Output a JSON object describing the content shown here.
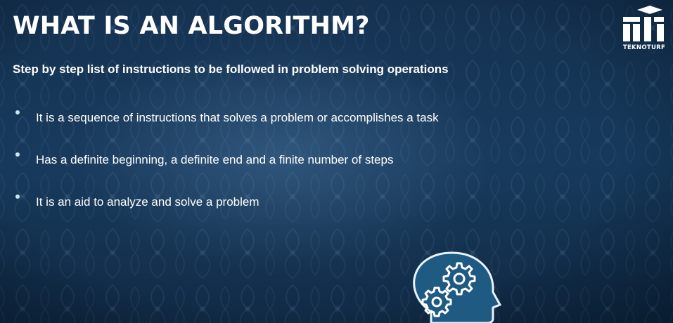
{
  "slide": {
    "title": "WHAT IS AN ALGORITHM?",
    "subtitle": "Step by step list of instructions to be followed in problem solving operations",
    "bullets": [
      "It is a sequence of instructions that solves a problem or accomplishes a task",
      "Has a definite beginning, a definite end and a finite number of steps",
      "It is an aid to analyze and solve a problem"
    ]
  },
  "logo": {
    "text": "TEKNOTURF",
    "icon": "teknoturf-logo-icon"
  },
  "illustration": {
    "icon": "head-gears-icon"
  },
  "colors": {
    "background": "#163a5c",
    "text": "#ffffff",
    "bullet": "#cfe6f2",
    "icon_fill": "#1f5a82"
  }
}
